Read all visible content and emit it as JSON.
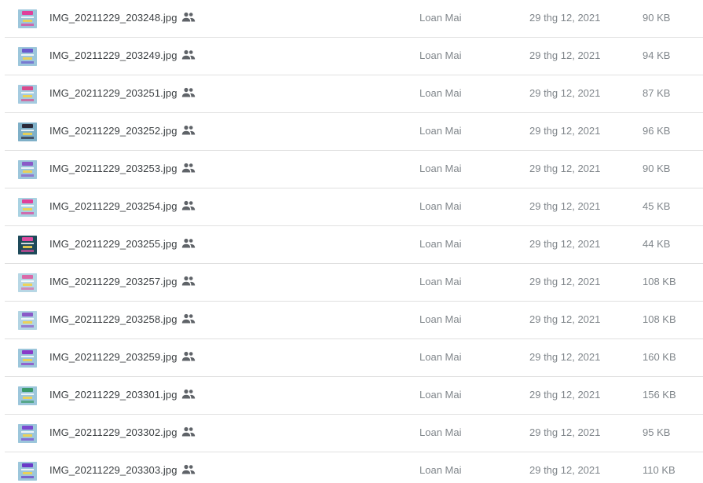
{
  "files": [
    {
      "name": "IMG_20211229_203248.jpg",
      "owner": "Loan Mai",
      "modified": "29 thg 12, 2021",
      "size": "90 KB",
      "thumb_bg": "#9cc6db",
      "thumb_accent": "#e0409a",
      "shared_icon": "people-icon"
    },
    {
      "name": "IMG_20211229_203249.jpg",
      "owner": "Loan Mai",
      "modified": "29 thg 12, 2021",
      "size": "94 KB",
      "thumb_bg": "#9cc6db",
      "thumb_accent": "#6a5acd",
      "shared_icon": "people-icon"
    },
    {
      "name": "IMG_20211229_203251.jpg",
      "owner": "Loan Mai",
      "modified": "29 thg 12, 2021",
      "size": "87 KB",
      "thumb_bg": "#a5cbe0",
      "thumb_accent": "#d94a8c",
      "shared_icon": "people-icon"
    },
    {
      "name": "IMG_20211229_203252.jpg",
      "owner": "Loan Mai",
      "modified": "29 thg 12, 2021",
      "size": "96 KB",
      "thumb_bg": "#7fb0c8",
      "thumb_accent": "#2a2a3a",
      "shared_icon": "people-icon"
    },
    {
      "name": "IMG_20211229_203253.jpg",
      "owner": "Loan Mai",
      "modified": "29 thg 12, 2021",
      "size": "90 KB",
      "thumb_bg": "#9cc6db",
      "thumb_accent": "#8a5ac8",
      "shared_icon": "people-icon"
    },
    {
      "name": "IMG_20211229_203254.jpg",
      "owner": "Loan Mai",
      "modified": "29 thg 12, 2021",
      "size": "45 KB",
      "thumb_bg": "#a9d2e2",
      "thumb_accent": "#e0409a",
      "shared_icon": "people-icon"
    },
    {
      "name": "IMG_20211229_203255.jpg",
      "owner": "Loan Mai",
      "modified": "29 thg 12, 2021",
      "size": "44 KB",
      "thumb_bg": "#1e4a5a",
      "thumb_accent": "#e04aa0",
      "shared_icon": "people-icon"
    },
    {
      "name": "IMG_20211229_203257.jpg",
      "owner": "Loan Mai",
      "modified": "29 thg 12, 2021",
      "size": "108 KB",
      "thumb_bg": "#b7d7e5",
      "thumb_accent": "#d96aa8",
      "shared_icon": "people-icon"
    },
    {
      "name": "IMG_20211229_203258.jpg",
      "owner": "Loan Mai",
      "modified": "29 thg 12, 2021",
      "size": "108 KB",
      "thumb_bg": "#b2d4e3",
      "thumb_accent": "#8a5ac8",
      "shared_icon": "people-icon"
    },
    {
      "name": "IMG_20211229_203259.jpg",
      "owner": "Loan Mai",
      "modified": "29 thg 12, 2021",
      "size": "160 KB",
      "thumb_bg": "#9cc6db",
      "thumb_accent": "#8a3ac8",
      "shared_icon": "people-icon"
    },
    {
      "name": "IMG_20211229_203301.jpg",
      "owner": "Loan Mai",
      "modified": "29 thg 12, 2021",
      "size": "156 KB",
      "thumb_bg": "#9cc6db",
      "thumb_accent": "#3a9a6a",
      "shared_icon": "people-icon"
    },
    {
      "name": "IMG_20211229_203302.jpg",
      "owner": "Loan Mai",
      "modified": "29 thg 12, 2021",
      "size": "95 KB",
      "thumb_bg": "#9cc6db",
      "thumb_accent": "#7a4ad0",
      "shared_icon": "people-icon"
    },
    {
      "name": "IMG_20211229_203303.jpg",
      "owner": "Loan Mai",
      "modified": "29 thg 12, 2021",
      "size": "110 KB",
      "thumb_bg": "#9cc6db",
      "thumb_accent": "#6a3ac8",
      "shared_icon": "people-icon"
    }
  ],
  "colors": {
    "text_primary": "#3c4043",
    "text_secondary": "#80868b",
    "divider": "#e0e0e0",
    "icon": "#5f6368"
  }
}
